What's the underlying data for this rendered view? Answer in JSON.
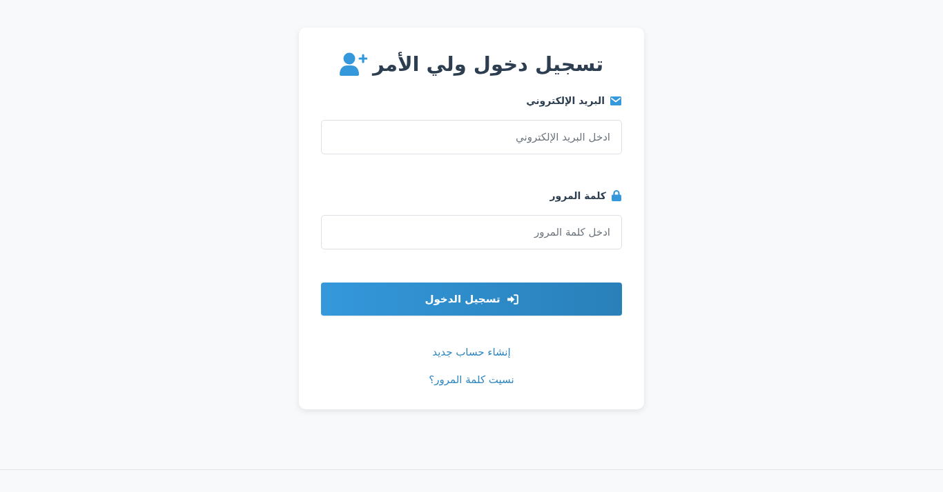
{
  "title": "تسجيل دخول ولي الأمر",
  "fields": [
    {
      "kind": "email",
      "label": "البريد الإلكتروني",
      "placeholder": "ادخل البريد الإلكتروني"
    },
    {
      "kind": "password",
      "label": "كلمة المرور",
      "placeholder": "ادخل كلمة المرور"
    }
  ],
  "submit_button": "تسجيل الدخول",
  "links": [
    "إنشاء حساب جديد",
    "نسيت كلمة المرور؟"
  ]
}
